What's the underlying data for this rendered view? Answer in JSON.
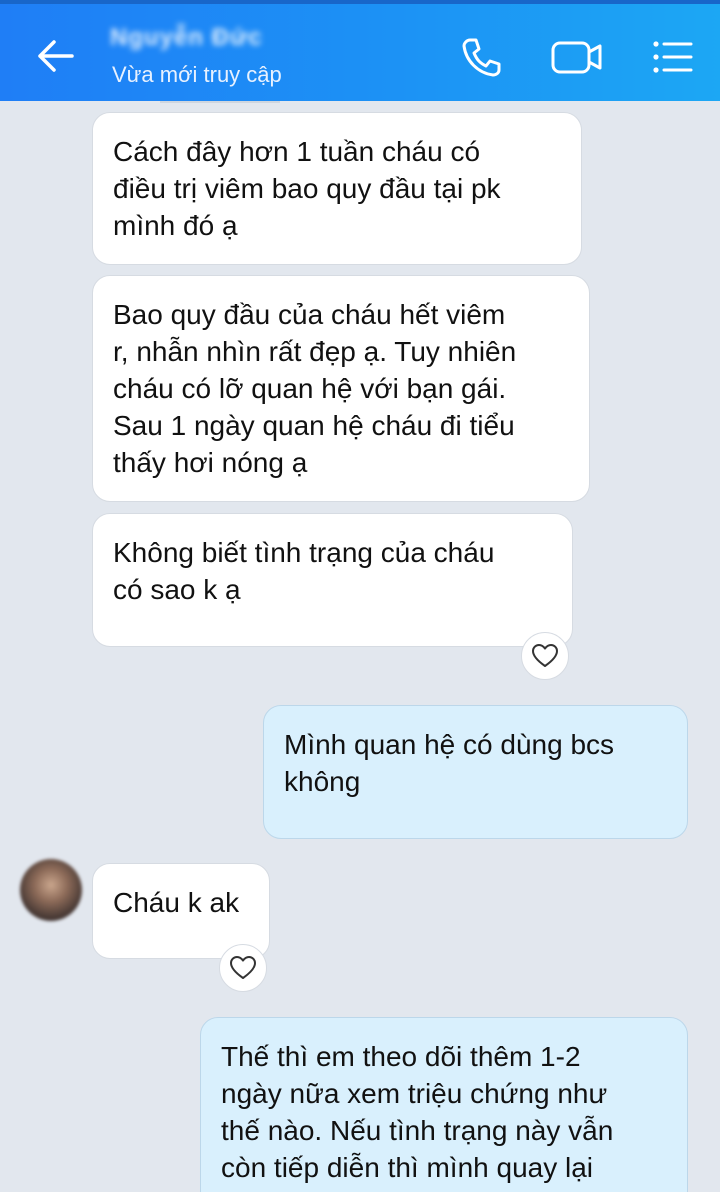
{
  "header": {
    "contact_name": "Nguyễn Đức",
    "status": "Vừa mới truy cập"
  },
  "icons": {
    "back": "arrow-left-icon",
    "call": "phone-icon",
    "video": "video-camera-icon",
    "menu": "list-menu-icon",
    "react": "heart-icon"
  },
  "colors": {
    "header_start": "#1f7ef6",
    "header_end": "#1ca7f4",
    "chat_background": "#e2e7ee",
    "incoming_bubble": "#ffffff",
    "outgoing_bubble": "#d9f0fd"
  },
  "messages": [
    {
      "direction": "incoming",
      "text": "Cách đây hơn 1 tuần cháu có\nđiều trị viêm bao quy đầu tại pk\nmình đó ạ"
    },
    {
      "direction": "incoming",
      "text": "Bao quy đầu của cháu hết viêm\nr, nhẫn nhìn rất đẹp ạ. Tuy nhiên\ncháu có lỡ quan hệ với bạn gái.\nSau 1 ngày quan hệ cháu đi tiểu\nthấy hơi nóng ạ"
    },
    {
      "direction": "incoming",
      "text": "Không biết tình trạng của cháu\ncó sao k ạ"
    },
    {
      "direction": "outgoing",
      "text": "Mình quan hệ có dùng bcs\nkhông"
    },
    {
      "direction": "incoming",
      "text": "Cháu k ak"
    },
    {
      "direction": "outgoing",
      "text": "Thế thì em theo dõi thêm 1-2\nngày nữa xem triệu chứng như\nthế nào. Nếu tình trạng này vẫn\ncòn tiếp diễn thì mình quay lại"
    }
  ]
}
